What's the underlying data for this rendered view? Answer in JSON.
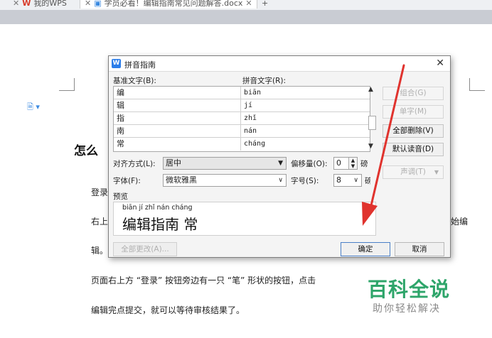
{
  "tabs": {
    "tab1_label": "我的WPS",
    "tab2_label": "学员必看！编辑指南常见问题解答.docx",
    "add_label": "+"
  },
  "document": {
    "title": "怎么",
    "line_login": "登录",
    "line_right_top": "右上",
    "line_right_top_end": "始编",
    "line_edit": "辑。",
    "line_page": "页面右上方 “登录” 按钮旁边有一只 “笔” 形状的按钮，点击",
    "line_finish": "编辑完点提交，就可以等待审核结果了。"
  },
  "dialog": {
    "title": "拼音指南",
    "col_base_label": "基准文字(B):",
    "col_pinyin_label": "拼音文字(R):",
    "rows": [
      {
        "base": "编",
        "pinyin": "biān"
      },
      {
        "base": "辑",
        "pinyin": "jí"
      },
      {
        "base": "指",
        "pinyin": "zhǐ"
      },
      {
        "base": "南",
        "pinyin": "nán"
      },
      {
        "base": "常",
        "pinyin": "cháng"
      }
    ],
    "align_label": "对齐方式(L):",
    "align_value": "居中",
    "offset_label": "偏移量(O):",
    "offset_value": "0",
    "offset_unit": "磅",
    "font_label": "字体(F):",
    "font_value": "微软雅黑",
    "size_label": "字号(S):",
    "size_value": "8",
    "size_unit": "磅",
    "preview_label": "预览",
    "preview_pinyin": "biān jí zhǐ nán cháng",
    "preview_text": "编辑指南 常",
    "btn_group": "组合(G)",
    "btn_single": "单字(M)",
    "btn_clear_all": "全部删除(V)",
    "btn_default_read": "默认读音(D)",
    "btn_tone": "声调(T)",
    "btn_change_all": "全部更改(A)...",
    "btn_ok": "确定",
    "btn_cancel": "取消"
  },
  "watermark": {
    "main": "百科全说",
    "sub": "助你轻松解决"
  },
  "colors": {
    "accent_blue": "#2b7de9",
    "arrow_red": "#e0332e",
    "watermark_green": "#2ea56a"
  }
}
